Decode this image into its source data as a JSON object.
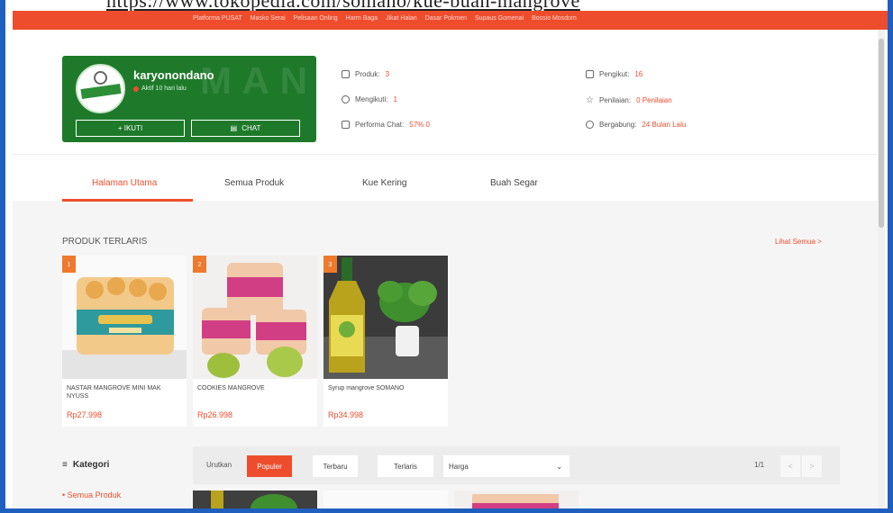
{
  "url_caption": "https://www.tokopedia.com/somano/kue-buah-mangrove",
  "topnav": {
    "links": [
      "Platforma PUSAT",
      "Masko Serai",
      "Pelisaan Onling",
      "Harm Baga",
      "Jikat Halan",
      "Dasar Pokmen",
      "Supaus Gomenai",
      "Bossio Mosdom"
    ]
  },
  "shop": {
    "name": "karyonondano",
    "active": "Aktif 10 hari lalu",
    "follow_label": "+ IKUTI",
    "chat_label": "CHAT"
  },
  "stats": {
    "products_label": "Produk:",
    "products_value": "3",
    "following_label": "Mengikuti:",
    "following_value": "1",
    "chat_label": "Performa Chat:",
    "chat_value": "57% 0",
    "followers_label": "Pengikut:",
    "followers_value": "16",
    "rating_label": "Penilaian:",
    "rating_value": "0 Penilaian",
    "joined_label": "Bergabung:",
    "joined_value": "24 Bulan Lalu"
  },
  "tabs": [
    "Halaman Utama",
    "Semua Produk",
    "Kue Kering",
    "Buah Segar"
  ],
  "section": {
    "title": "PRODUK TERLARIS",
    "see_all": "Lihat Semua >"
  },
  "products": [
    {
      "badge": "1",
      "name": "NASTAR MANGROVE MINI MAK NYUSS",
      "price": "Rp27.998"
    },
    {
      "badge": "2",
      "name": "COOKIES MANGROVE",
      "price": "Rp26.998"
    },
    {
      "badge": "3",
      "name": "Syrup mangrove SOMANO",
      "price": "Rp34.998"
    }
  ],
  "category": {
    "title": "Kategori",
    "all": "• Semua Produk"
  },
  "sortbar": {
    "label": "Urutkan",
    "popular": "Populer",
    "newest": "Terbaru",
    "bestseller": "Terlaris",
    "price": "Harga",
    "page": "1/1",
    "prev": "<",
    "next": ">"
  },
  "colors": {
    "brand": "#ee4d2d",
    "shop_card": "#1e7a2a",
    "frame": "#1f5fbf"
  }
}
